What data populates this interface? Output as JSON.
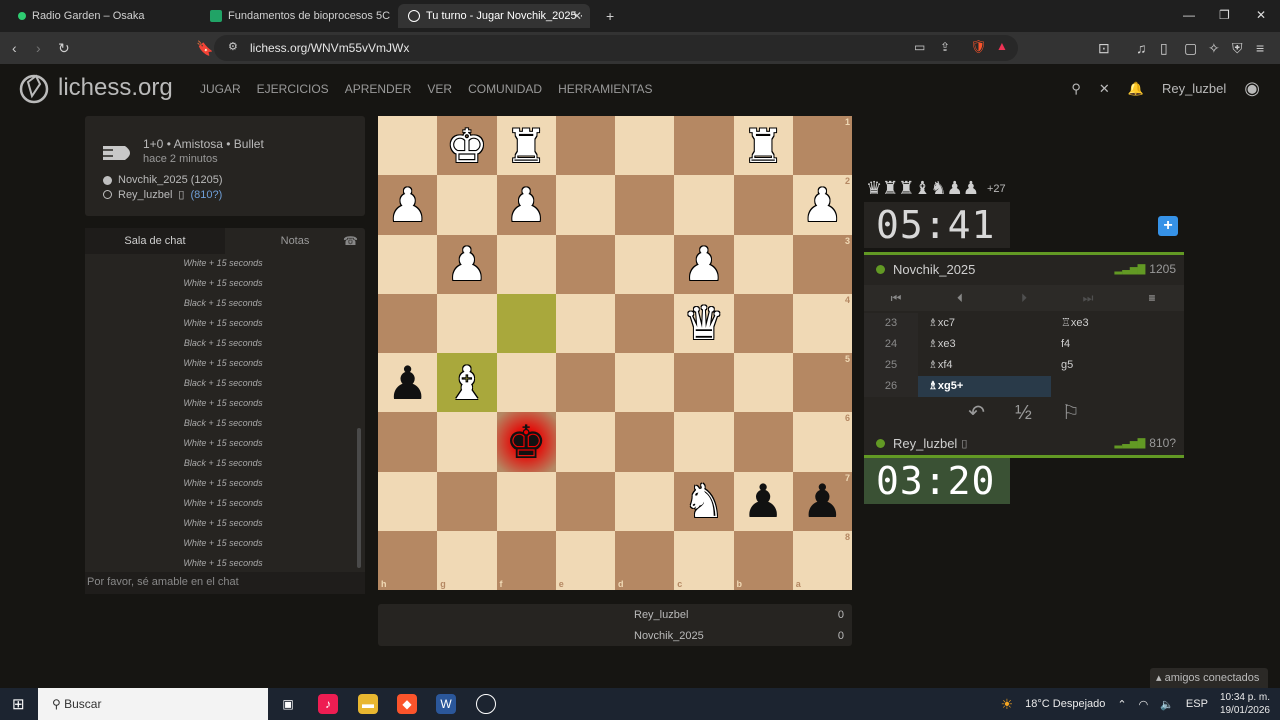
{
  "browser": {
    "tabs": [
      {
        "title": "Radio Garden – Osaka",
        "icon": "radio-dot-icon",
        "color": "#2ecc71"
      },
      {
        "title": "Fundamentos de bioprocesos 5C",
        "icon": "sheets-icon",
        "color": "#21a366"
      },
      {
        "title": "Tu turno - Jugar Novchik_2025 ·",
        "icon": "lichess-icon",
        "color": "#ffffff"
      }
    ],
    "new_tab": "+",
    "url": "lichess.org/WNVm55vVmJWx"
  },
  "site": {
    "logo": "lichess.org",
    "nav": [
      "JUGAR",
      "EJERCICIOS",
      "APRENDER",
      "VER",
      "COMUNIDAD",
      "HERRAMIENTAS"
    ],
    "username": "Rey_luzbel"
  },
  "game_info": {
    "speed": "1+0 • Amistosa • Bullet",
    "when": "hace 2 minutos",
    "white": "Novchik_2025 (1205)",
    "black_name": "Rey_luzbel",
    "black_rating": "(810?)"
  },
  "chat": {
    "tab_chat": "Sala de chat",
    "tab_notes": "Notas",
    "lines": [
      "White + 15 seconds",
      "White + 15 seconds",
      "Black + 15 seconds",
      "White + 15 seconds",
      "Black + 15 seconds",
      "White + 15 seconds",
      "Black + 15 seconds",
      "White + 15 seconds",
      "Black + 15 seconds",
      "White + 15 seconds",
      "Black + 15 seconds",
      "White + 15 seconds",
      "White + 15 seconds",
      "White + 15 seconds",
      "White + 15 seconds",
      "White + 15 seconds"
    ],
    "placeholder": "Por favor, sé amable en el chat"
  },
  "board": {
    "ranks": [
      "1",
      "2",
      "3",
      "4",
      "5",
      "6",
      "7",
      "8"
    ],
    "files": [
      "h",
      "g",
      "f",
      "e",
      "d",
      "c",
      "b",
      "a"
    ],
    "squares": [
      [
        "",
        "wK",
        "wR",
        "",
        "",
        "",
        "wR",
        ""
      ],
      [
        "wP",
        "",
        "wP",
        "",
        "",
        "",
        "",
        "wP"
      ],
      [
        "",
        "wP",
        "",
        "",
        "",
        "wP",
        "",
        ""
      ],
      [
        "",
        "",
        "",
        "",
        "",
        "wQ",
        "",
        ""
      ],
      [
        "bP",
        "wB",
        "",
        "",
        "",
        "",
        "",
        ""
      ],
      [
        "",
        "",
        "bK",
        "",
        "",
        "",
        "",
        ""
      ],
      [
        "",
        "",
        "",
        "",
        "",
        "wN",
        "bP",
        "bP"
      ],
      [
        "",
        "",
        "",
        "",
        "",
        "",
        "",
        ""
      ]
    ],
    "highlight": [
      [
        3,
        2
      ],
      [
        4,
        1
      ]
    ],
    "check": [
      5,
      2
    ]
  },
  "score": {
    "p1": "Rey_luzbel",
    "p1_score": "0",
    "p2": "Novchik_2025",
    "p2_score": "0"
  },
  "right": {
    "material_pieces": "♛♜♜♝♞♟♟",
    "material_diff": "+27",
    "top_clock": "05:41",
    "bottom_clock": "03:20",
    "top_player": "Novchik_2025",
    "top_rating": "1205",
    "bottom_player": "Rey_luzbel",
    "bottom_rating": "810?",
    "moves": [
      {
        "n": "23",
        "w": "♗xc7",
        "b": "♖xe3"
      },
      {
        "n": "24",
        "w": "♗xe3",
        "b": "f4"
      },
      {
        "n": "25",
        "w": "♗xf4",
        "b": "g5"
      },
      {
        "n": "26",
        "w": "♗xg5+",
        "b": ""
      }
    ],
    "draw": "½"
  },
  "friends": "amigos conectados",
  "taskbar": {
    "search": "Buscar",
    "weather": "18°C Despejado",
    "lang": "ESP",
    "time": "10:34 p. m.",
    "date": "19/01/2026"
  }
}
